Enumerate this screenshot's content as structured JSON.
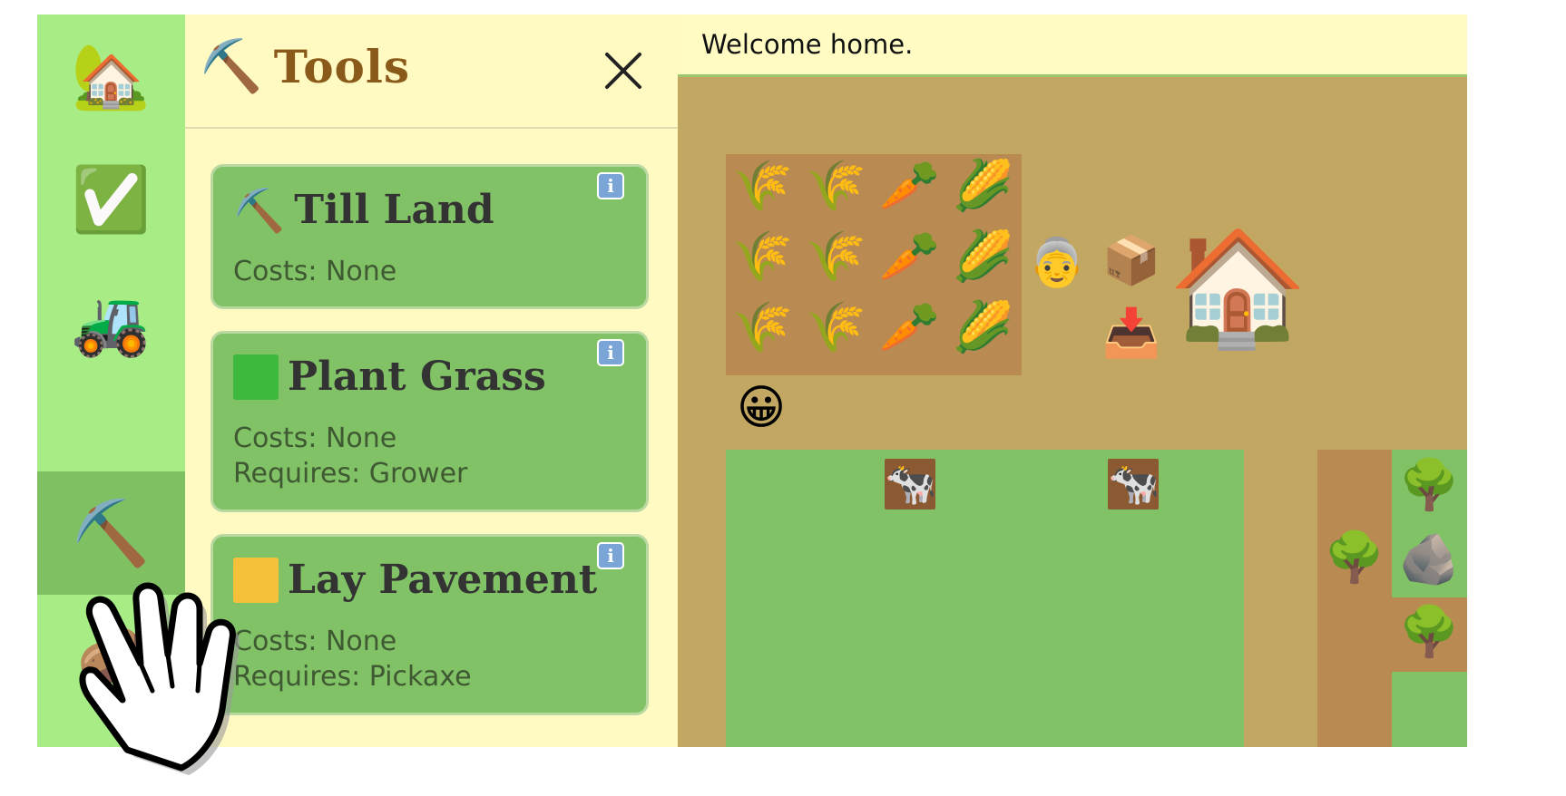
{
  "sidebar": {
    "items": [
      {
        "name": "home",
        "icon": "🏡"
      },
      {
        "name": "tasks",
        "icon": "✅"
      },
      {
        "name": "tractor",
        "icon": "🚜"
      },
      {
        "name": "tools",
        "icon": "⛏️"
      },
      {
        "name": "seeds",
        "icon": "🥔"
      }
    ]
  },
  "tools_panel": {
    "title_icon": "⛏️",
    "title": "Tools",
    "close_icon": "×",
    "cards": [
      {
        "icon": "⛏️",
        "name": "Till Land",
        "costs": "Costs: None",
        "requires": ""
      },
      {
        "swatch_color": "#3dba3d",
        "name": "Plant Grass",
        "costs": "Costs: None",
        "requires": "Requires: Grower"
      },
      {
        "swatch_color": "#f5c13b",
        "name": "Lay Pavement",
        "costs": "Costs: None",
        "requires": "Requires: Pickaxe"
      }
    ],
    "info_label": "i"
  },
  "game": {
    "message": "Welcome home.",
    "crops": {
      "rows": [
        [
          "🌾",
          "🌾",
          "🥕",
          "🌽"
        ],
        [
          "🌾",
          "🌾",
          "🥕",
          "🌽"
        ],
        [
          "🌾",
          "🌾",
          "🥕",
          "🌽"
        ]
      ]
    },
    "objects": {
      "farmer": "👵",
      "package": "📦",
      "inbox": "📥",
      "house": "🏠",
      "player": "😀",
      "cow": "🐄",
      "tree": "🌳",
      "rock": "🪨"
    }
  },
  "colors": {
    "sidebar": "#a8ec86",
    "panel": "#fff9c2",
    "card": "#80c265",
    "dirt": "#c2a763",
    "tilled": "#b98a52",
    "grass": "#80c265"
  }
}
